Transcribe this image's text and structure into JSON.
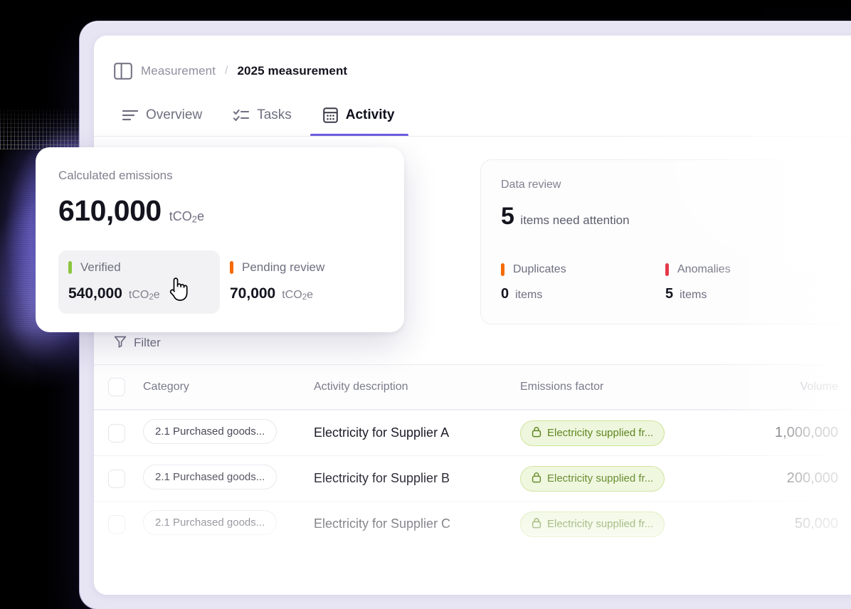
{
  "breadcrumb": {
    "panel_icon": "sidebar-panel-icon",
    "parent": "Measurement",
    "separator": "/",
    "current": "2025 measurement"
  },
  "tabs": [
    {
      "label": "Overview",
      "icon": "list-lines-icon",
      "active": false
    },
    {
      "label": "Tasks",
      "icon": "checklist-icon",
      "active": false
    },
    {
      "label": "Activity",
      "icon": "calculator-icon",
      "active": true
    }
  ],
  "emissions_card": {
    "label": "Calculated emissions",
    "total_value": "610,000",
    "total_unit_prefix": "tCO",
    "total_unit_sub": "2",
    "total_unit_suffix": "e",
    "breakdown": [
      {
        "status": "Verified",
        "value": "540,000",
        "unit_prefix": "tCO",
        "unit_sub": "2",
        "unit_suffix": "e",
        "marker_color": "#8cc63f",
        "hovered": true
      },
      {
        "status": "Pending review",
        "value": "70,000",
        "unit_prefix": "tCO",
        "unit_sub": "2",
        "unit_suffix": "e",
        "marker_color": "#f56a05",
        "hovered": false
      }
    ]
  },
  "data_review_card": {
    "label": "Data review",
    "headline_number": "5",
    "headline_text": "items need attention",
    "metrics": [
      {
        "label": "Duplicates",
        "count": "0",
        "unit": "items",
        "marker_color": "#f56a05"
      },
      {
        "label": "Anomalies",
        "count": "5",
        "unit": "items",
        "marker_color": "#e5394a"
      }
    ]
  },
  "filter": {
    "label": "Filter",
    "icon": "funnel-icon"
  },
  "table": {
    "columns": [
      "Category",
      "Activity description",
      "Emissions factor",
      "Volume"
    ],
    "rows": [
      {
        "category": "2.1 Purchased goods...",
        "activity": "Electricity for Supplier A",
        "emissions_factor": "Electricity supplied fr...",
        "factor_icon": "lock-icon",
        "volume": "1,000,000"
      },
      {
        "category": "2.1 Purchased goods...",
        "activity": "Electricity for Supplier B",
        "emissions_factor": "Electricity supplied fr...",
        "factor_icon": "lock-icon",
        "volume": "200,000"
      },
      {
        "category": "2.1 Purchased goods...",
        "activity": "Electricity for Supplier C",
        "emissions_factor": "Electricity supplied fr...",
        "factor_icon": "lock-icon",
        "volume": "50,000"
      }
    ]
  },
  "colors": {
    "accent_purple": "#6c5ce0",
    "verified_green": "#8cc63f",
    "pending_orange": "#f56a05",
    "anomaly_red": "#e5394a",
    "tag_green_text": "#5f8521",
    "tag_green_bg": "#eef7dd",
    "background": "#000000",
    "frame_lavender": "#e7e5f3"
  },
  "cursor": {
    "type": "pointer-hand-cursor"
  }
}
